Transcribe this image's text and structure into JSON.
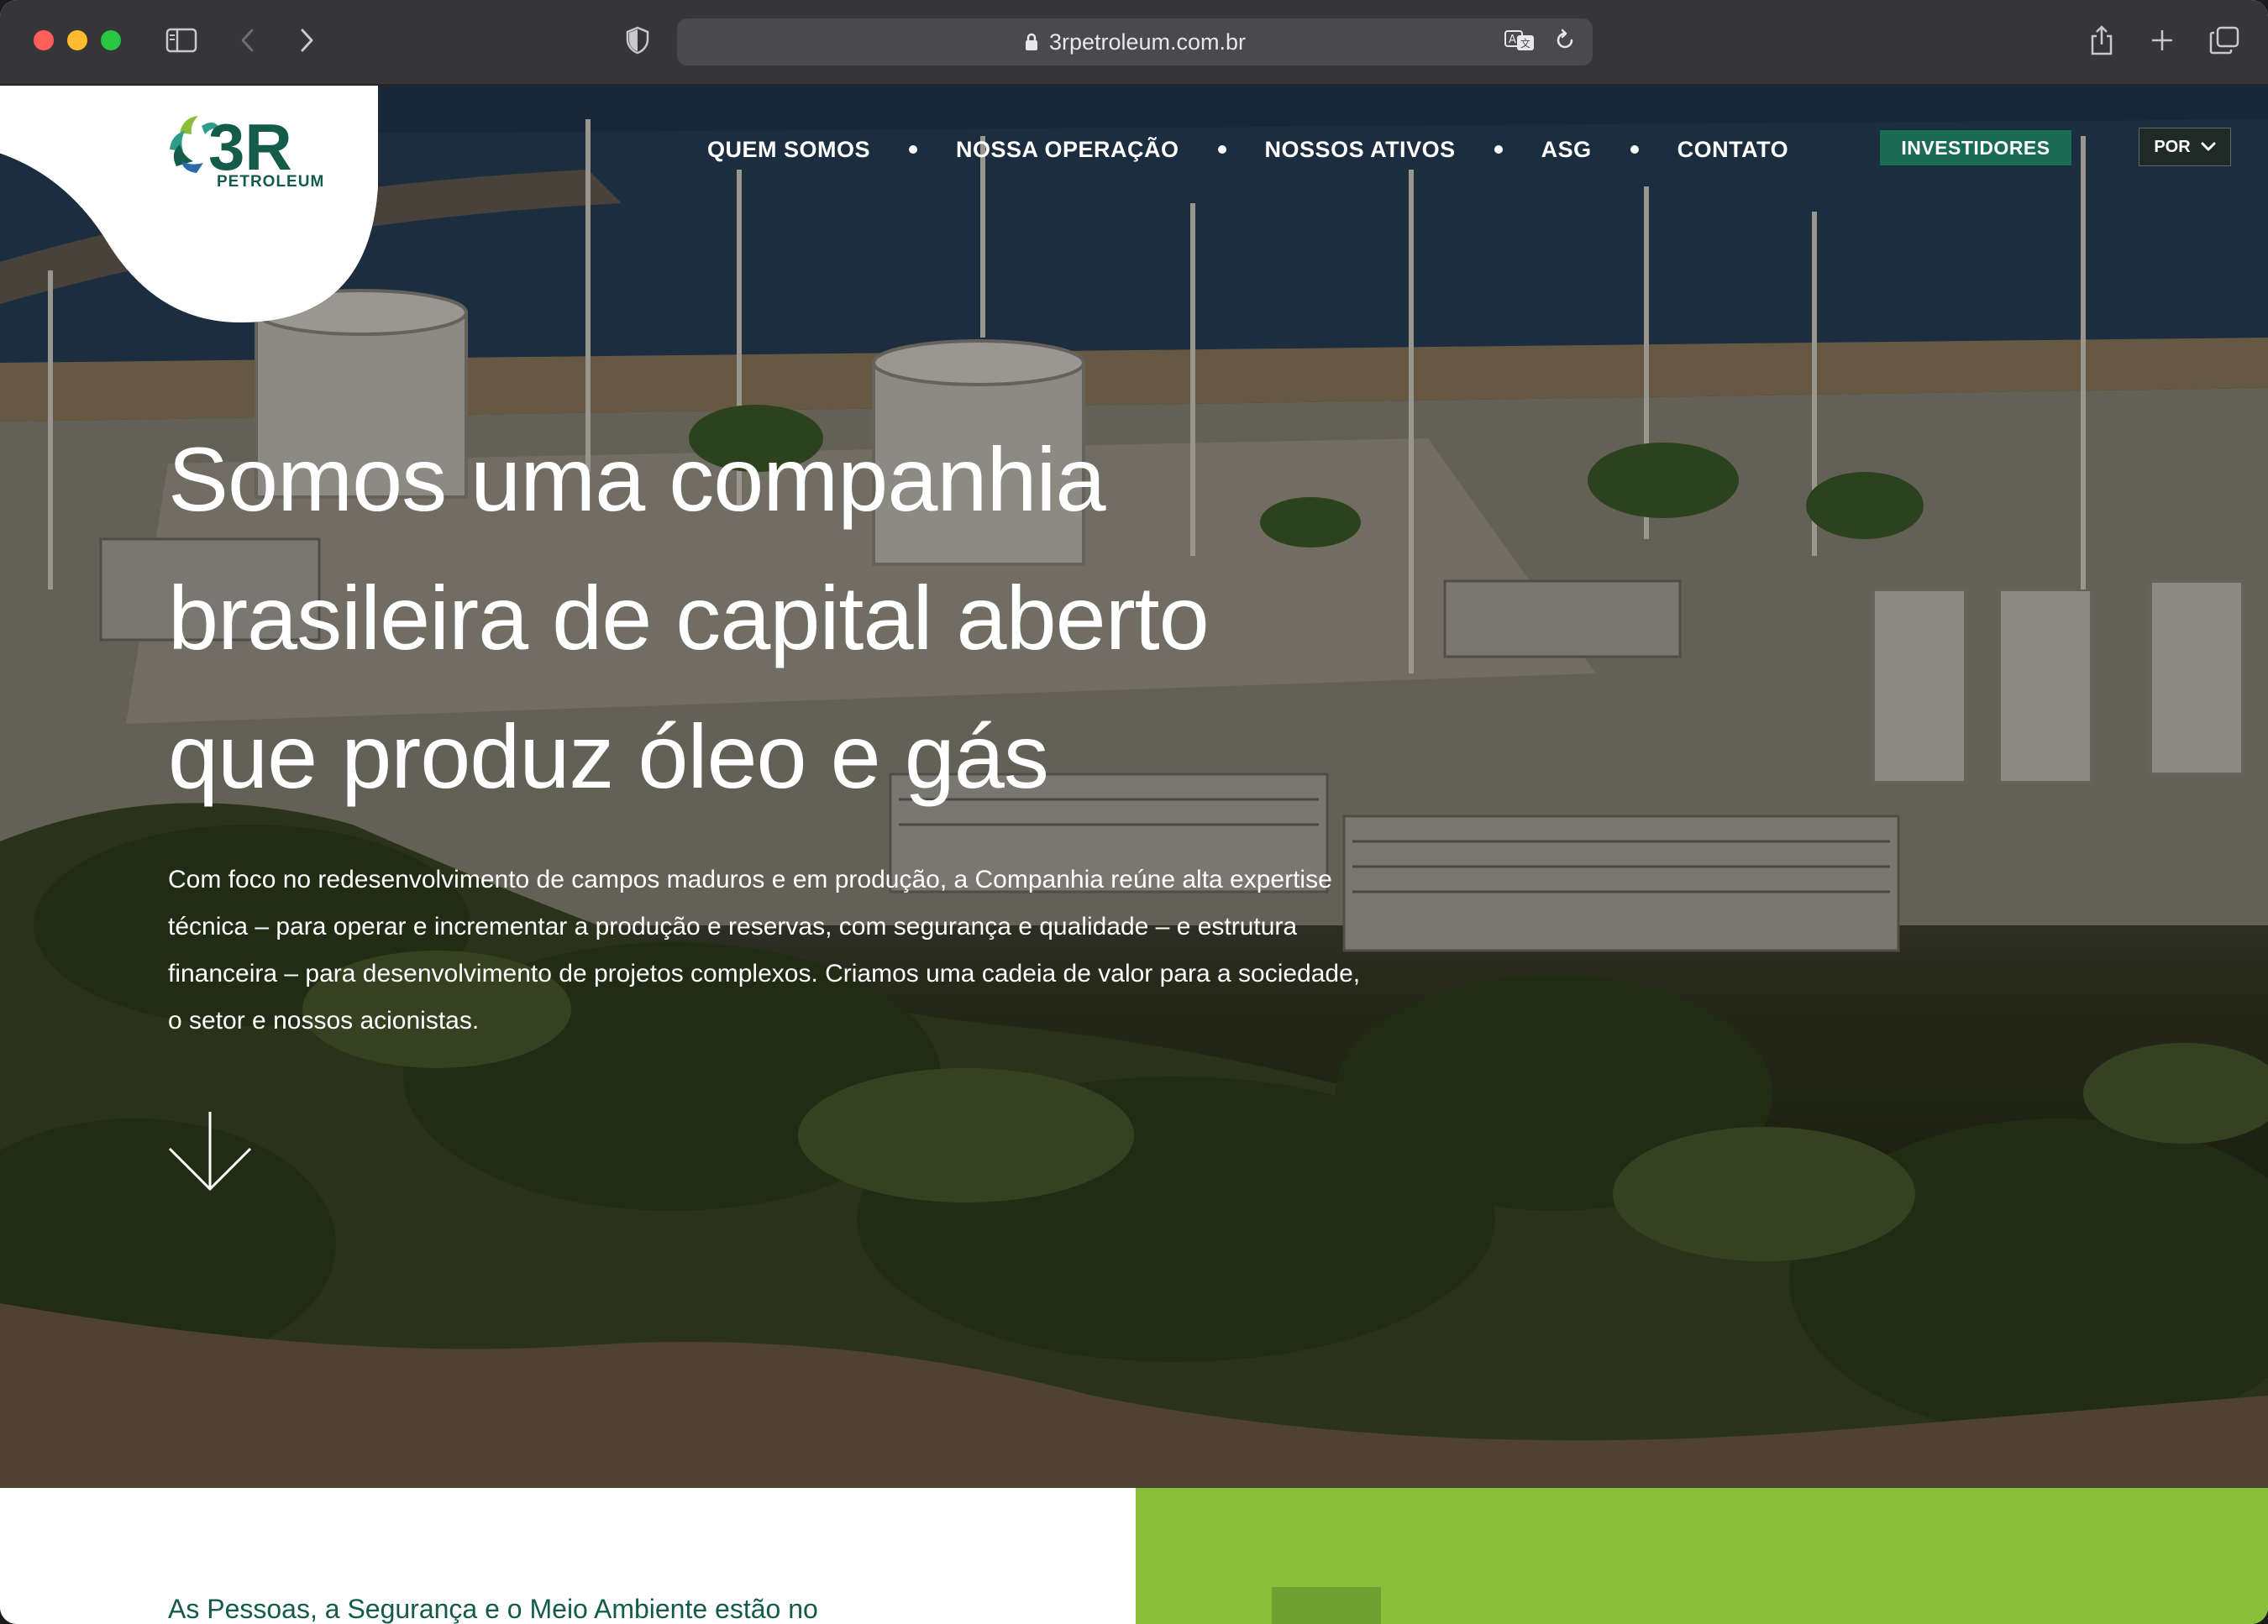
{
  "browser": {
    "url": "3rpetroleum.com.br"
  },
  "logo": {
    "mark": "3R",
    "text": "PETROLEUM"
  },
  "nav": {
    "items": [
      "QUEM SOMOS",
      "NOSSA OPERAÇÃO",
      "NOSSOS ATIVOS",
      "ASG",
      "CONTATO"
    ],
    "investors_label": "INVESTIDORES",
    "language": "POR"
  },
  "hero": {
    "title_lines": [
      "Somos uma companhia",
      "brasileira de capital aberto",
      "que produz óleo e gás"
    ],
    "text_lines": [
      "Com foco no redesenvolvimento de campos maduros e em produção, a Companhia reúne alta expertise",
      "técnica – para operar e incrementar a produção e reservas, com segurança e qualidade – e estrutura",
      "financeira – para desenvolvimento de projetos complexos. Criamos uma cadeia de valor para a sociedade,",
      "o setor e nossos acionistas."
    ]
  },
  "section2": {
    "heading": "As Pessoas, a Segurança e o Meio Ambiente estão no"
  },
  "colors": {
    "brand_green": "#1b6b52",
    "accent_lime": "#8abd3a",
    "logo_teal": "#155b4a"
  }
}
